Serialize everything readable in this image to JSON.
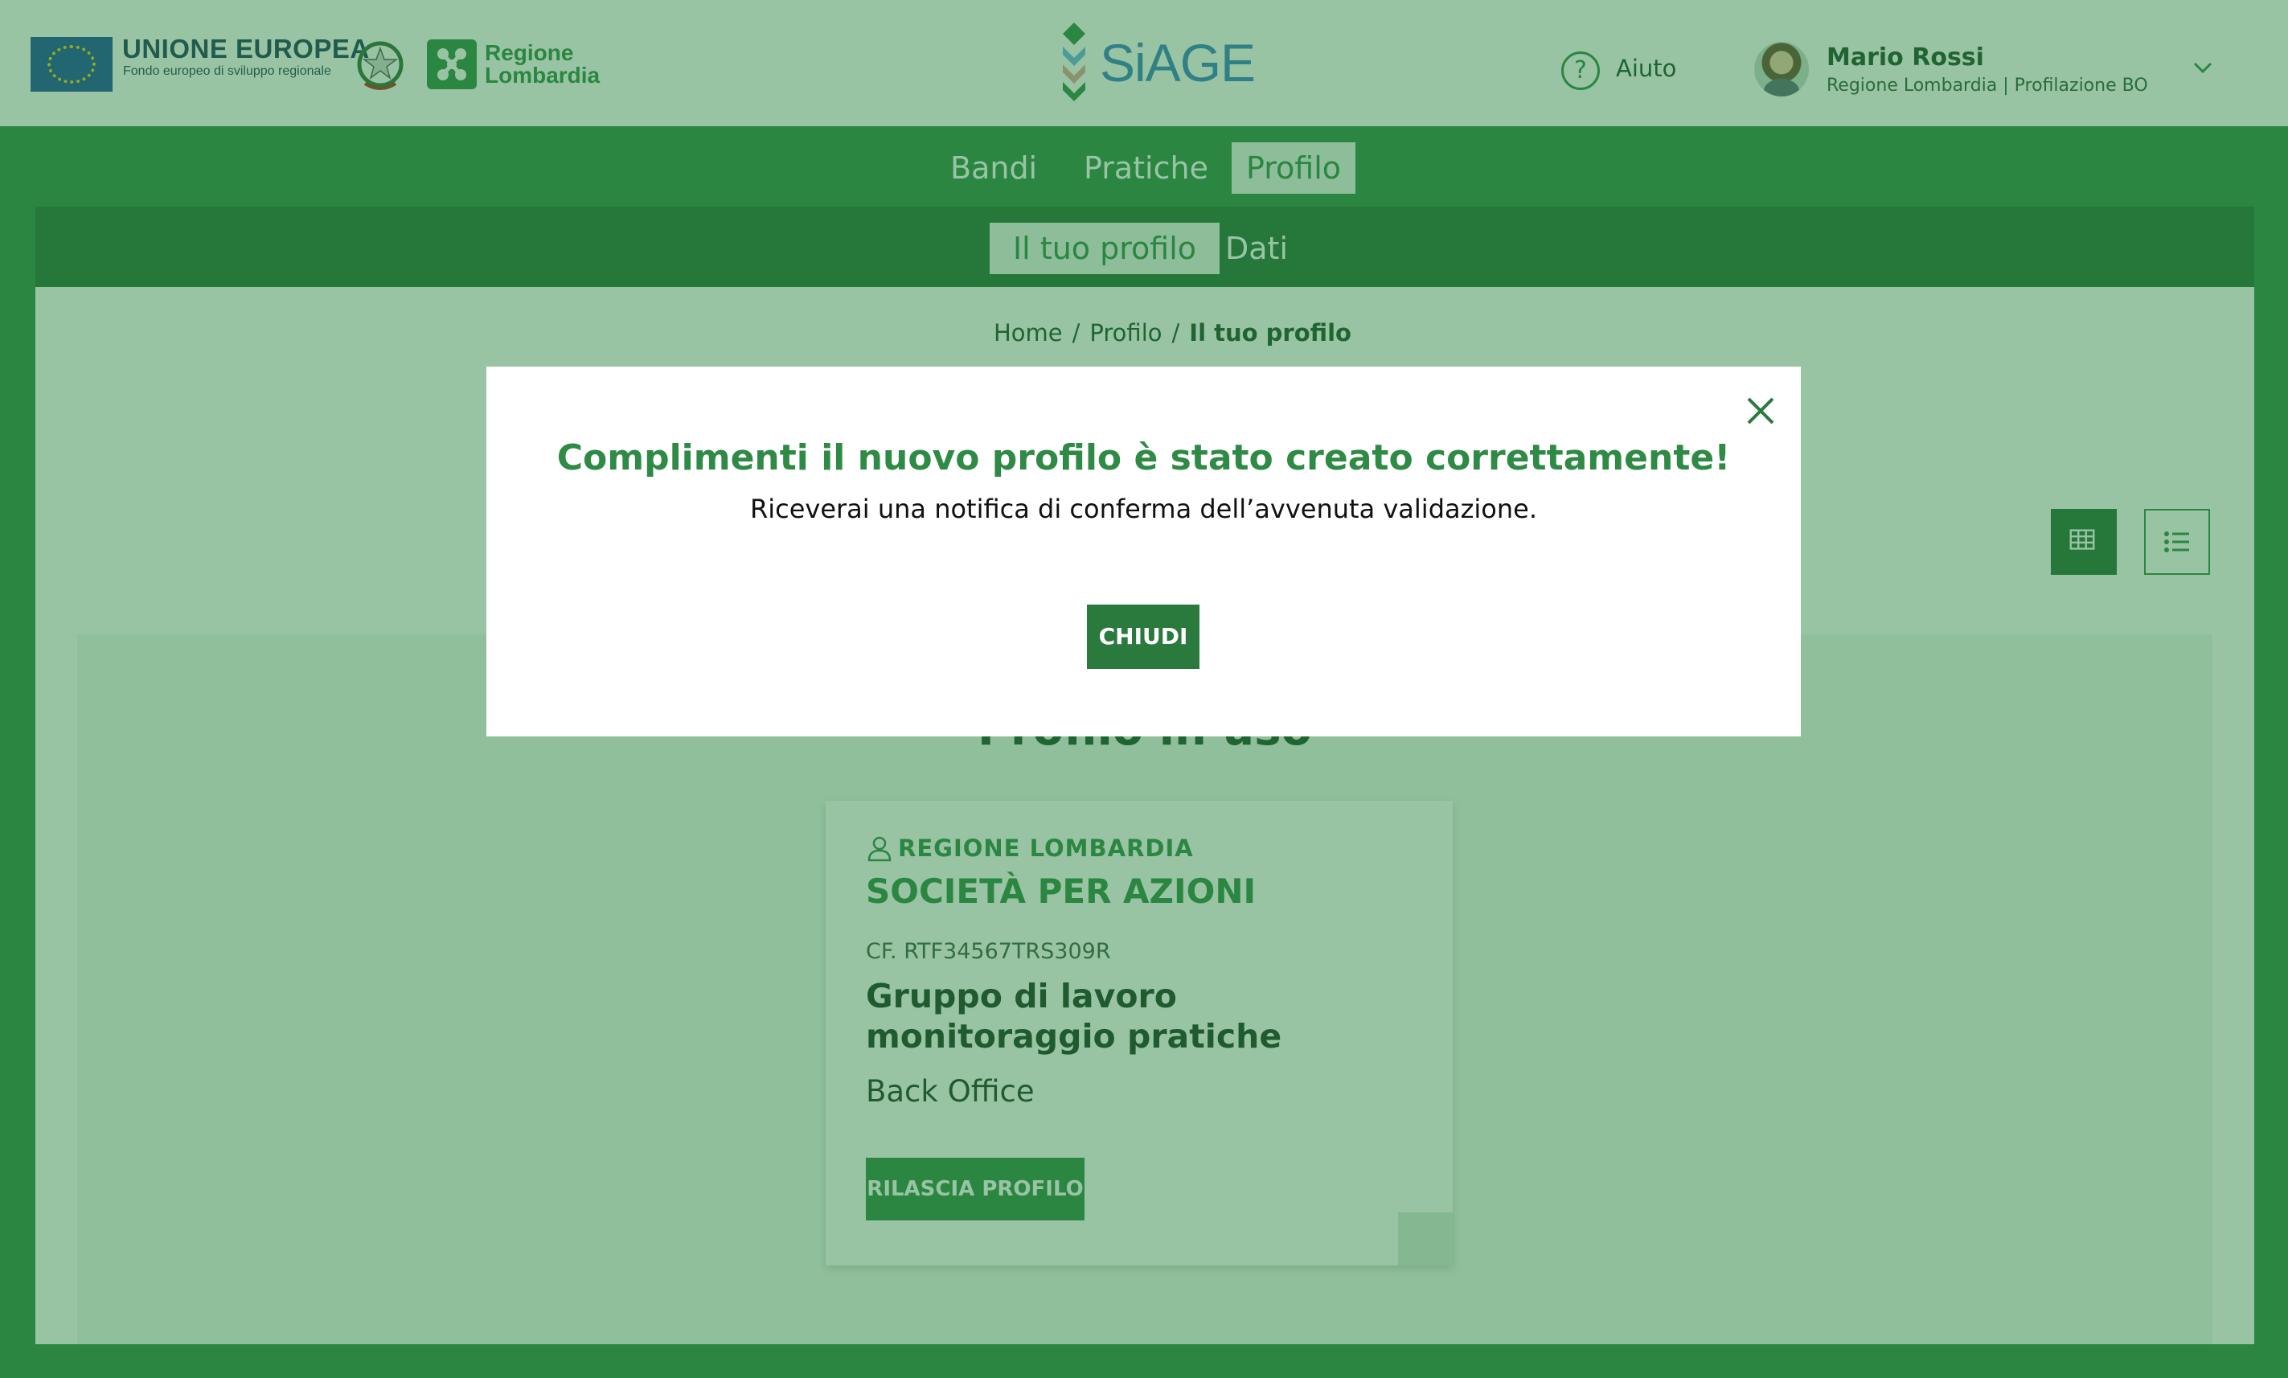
{
  "header": {
    "eu_title": "UNIONE EUROPEA",
    "eu_subtitle": "Fondo europeo di sviluppo regionale",
    "region_logo_line1": "Regione",
    "region_logo_line2": "Lombardia",
    "app_name": "SiAGE",
    "help_label": "Aiuto",
    "user": {
      "name": "Mario Rossi",
      "org": "Regione Lombardia  |  Profilazione BO"
    }
  },
  "nav": {
    "items": [
      {
        "label": "Bandi"
      },
      {
        "label": "Pratiche"
      },
      {
        "label": "Profilo",
        "active": true
      }
    ]
  },
  "subnav": {
    "items": [
      {
        "label": "Il tuo profilo",
        "active": true
      },
      {
        "label": "Dati"
      }
    ]
  },
  "breadcrumb": {
    "items": [
      "Home",
      "Profilo",
      "Il tuo profilo"
    ],
    "separator": "/"
  },
  "panel": {
    "title": "Profilo in uso"
  },
  "card": {
    "org": "REGIONE LOMBARDIA",
    "company": "SOCIETÀ PER AZIONI",
    "cf": "CF. RTF34567TRS309R",
    "group": "Gruppo di lavoro monitoraggio pratiche",
    "role": "Back Office",
    "button": "RILASCIA PROFILO"
  },
  "modal": {
    "title": "Complimenti il nuovo profilo è stato creato correttamente!",
    "message": "Riceverai una notifica di conferma dell’avvenuta validazione.",
    "button": "CHIUDI"
  },
  "colors": {
    "brand_green": "#2f8a45",
    "dark_green": "#256e37",
    "overlay": "rgba(38,130,62,0.47)",
    "siage_blue": "#3a7fc4"
  },
  "icons": {
    "help": "help-circle-icon",
    "chevron": "chevron-down-icon",
    "close": "close-icon",
    "grid_view": "grid-view-icon",
    "list_view": "list-view-icon",
    "user": "user-outline-icon"
  }
}
